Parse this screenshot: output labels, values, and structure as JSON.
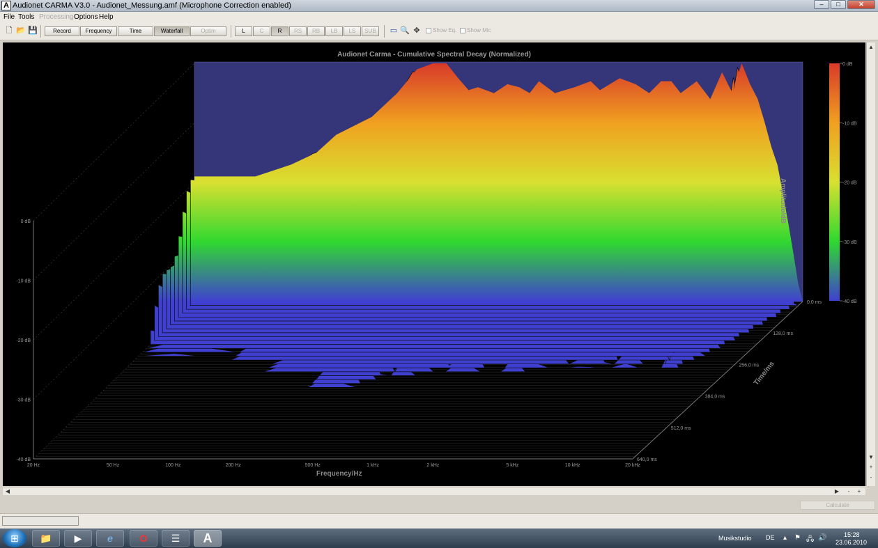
{
  "window": {
    "title": "Audionet CARMA V3.0 - Audionet_Messung.amf (Microphone Correction enabled)",
    "icon_letter": "A",
    "min_label": "–",
    "max_label": "□",
    "close_label": "✕"
  },
  "menu": [
    {
      "label": "File",
      "disabled": false
    },
    {
      "label": "Tools",
      "disabled": false
    },
    {
      "label": "Processing",
      "disabled": true
    },
    {
      "label": "Options",
      "disabled": false
    },
    {
      "label": "Help",
      "disabled": false
    }
  ],
  "toolbar": {
    "file_icons": [
      "new-file-icon",
      "open-folder-icon",
      "save-disk-icon"
    ],
    "view_buttons": [
      {
        "label": "Record",
        "active": false,
        "disabled": false
      },
      {
        "label": "Frequency",
        "active": false,
        "disabled": false
      },
      {
        "label": "Time",
        "active": false,
        "disabled": false
      },
      {
        "label": "Waterfall",
        "active": true,
        "disabled": false
      },
      {
        "label": "Optim",
        "active": false,
        "disabled": true
      }
    ],
    "channel_buttons": [
      {
        "label": "L",
        "active": false,
        "disabled": false
      },
      {
        "label": "C",
        "active": false,
        "disabled": true
      },
      {
        "label": "R",
        "active": true,
        "disabled": false
      },
      {
        "label": "RS",
        "active": false,
        "disabled": true
      },
      {
        "label": "RB",
        "active": false,
        "disabled": true
      },
      {
        "label": "LB",
        "active": false,
        "disabled": true
      },
      {
        "label": "LS",
        "active": false,
        "disabled": true
      },
      {
        "label": "SUB",
        "active": false,
        "disabled": true
      }
    ],
    "view_icons": [
      "window-icon",
      "zoom-icon",
      "move-icon"
    ],
    "show_eq_label": "Show Eq.",
    "show_mic_label": "Show Mic"
  },
  "chart_data": {
    "type": "area",
    "title": "Audionet Carma - Cumulative Spectral Decay (Normalized)",
    "xlabel": "Frequency/Hz",
    "ylabel": "Amplitude/dB",
    "zlabel": "Time/ms",
    "x_ticks": [
      "20 Hz",
      "50 Hz",
      "100 Hz",
      "200 Hz",
      "500 Hz",
      "1 kHz",
      "2 kHz",
      "5 kHz",
      "10 kHz",
      "20 kHz"
    ],
    "x_tick_values": [
      20,
      50,
      100,
      200,
      500,
      1000,
      2000,
      5000,
      10000,
      20000
    ],
    "y_ticks": [
      "0 dB",
      "-10 dB",
      "-20 dB",
      "-30 dB",
      "-40 dB"
    ],
    "y_tick_values": [
      0,
      -10,
      -20,
      -30,
      -40
    ],
    "time_ticks": [
      "0,0 ms",
      "128,0 ms",
      "256,0 ms",
      "384,0 ms",
      "512,0 ms",
      "640,0 ms"
    ],
    "time_tick_values": [
      0,
      128,
      256,
      384,
      512,
      640
    ],
    "colorbar_ticks": [
      "0 dB",
      "-10 dB",
      "-20 dB",
      "-30 dB",
      "-40 dB"
    ],
    "colorbar_colors": [
      "#d83a2a",
      "#f0a020",
      "#d8e030",
      "#30d830",
      "#4040d0"
    ],
    "background_color": "#000000",
    "front_slice": {
      "name": "",
      "x": [
        20,
        30,
        40,
        60,
        80,
        100,
        150,
        200,
        250,
        300,
        350,
        400,
        450,
        500,
        600,
        700,
        800,
        900,
        1000,
        1200,
        1500,
        1800,
        2000,
        2500,
        3000,
        3500,
        4000,
        4500,
        5000,
        6000,
        7000,
        8000,
        9000,
        10000,
        11000,
        12000,
        13000,
        14000,
        15000,
        16000,
        17000,
        18000,
        19000,
        20000
      ],
      "y": [
        -19,
        -19,
        -19,
        -17,
        -15,
        -12,
        -9,
        -5,
        -1,
        1.5,
        0,
        -2.5,
        -4.5,
        -4,
        -5,
        -3.5,
        -4,
        -5,
        -3,
        -5,
        -4,
        -3,
        -4.5,
        -2.5,
        -3.5,
        -5,
        -3,
        -3,
        -5,
        -3,
        -6,
        -1.5,
        -5,
        1.5,
        -3.5,
        -6,
        -10,
        -14,
        -17,
        -22,
        -27,
        -32,
        -37,
        -40
      ]
    },
    "colorbar_range": [
      -40,
      0
    ],
    "ylim": [
      -40,
      0
    ],
    "time_range": [
      0,
      640
    ],
    "x_scale": "log",
    "grid": false,
    "legend": "none"
  },
  "statusbar": {
    "calculate_label": "Calculate"
  },
  "taskbar": {
    "apps": [
      {
        "name": "explorer-icon",
        "glyph": "📁",
        "active": false
      },
      {
        "name": "media-player-icon",
        "glyph": "▶",
        "active": false
      },
      {
        "name": "internet-explorer-icon",
        "glyph": "e",
        "active": false
      },
      {
        "name": "opera-icon",
        "glyph": "O",
        "active": false
      },
      {
        "name": "task-list-icon",
        "glyph": "☰",
        "active": false
      },
      {
        "name": "carma-app-icon",
        "glyph": "A",
        "active": true
      }
    ],
    "user_label": "Musikstudio",
    "language": "DE",
    "time": "15:28",
    "date": "23.06.2010"
  }
}
